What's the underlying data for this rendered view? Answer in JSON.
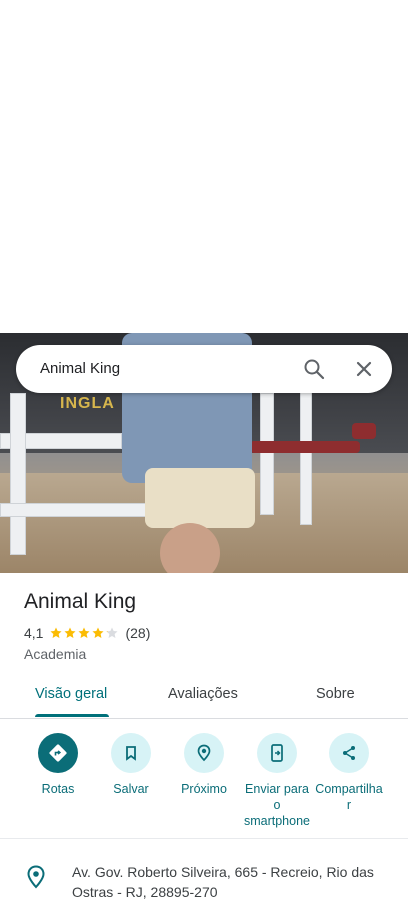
{
  "search": {
    "query": "Animal King"
  },
  "photo": {
    "sign_text": "INGLA"
  },
  "place": {
    "name": "Animal King",
    "rating": "4,1",
    "rating_value": 4.1,
    "review_count": "(28)",
    "category": "Academia"
  },
  "tabs": [
    {
      "label": "Visão geral",
      "active": true
    },
    {
      "label": "Avaliações",
      "active": false
    },
    {
      "label": "Sobre",
      "active": false
    }
  ],
  "actions": {
    "directions": "Rotas",
    "save": "Salvar",
    "nearby": "Próximo",
    "send_line1": "Enviar para",
    "send_line2": "o",
    "send_line3": "smartphone",
    "share_line1": "Compartilha",
    "share_line2": "r"
  },
  "address": "Av. Gov. Roberto Silveira, 665 - Recreio, Rio das Ostras - RJ, 28895-270",
  "colors": {
    "accent": "#0b6d78",
    "star": "#fbbc04",
    "star_empty": "#dadce0"
  }
}
